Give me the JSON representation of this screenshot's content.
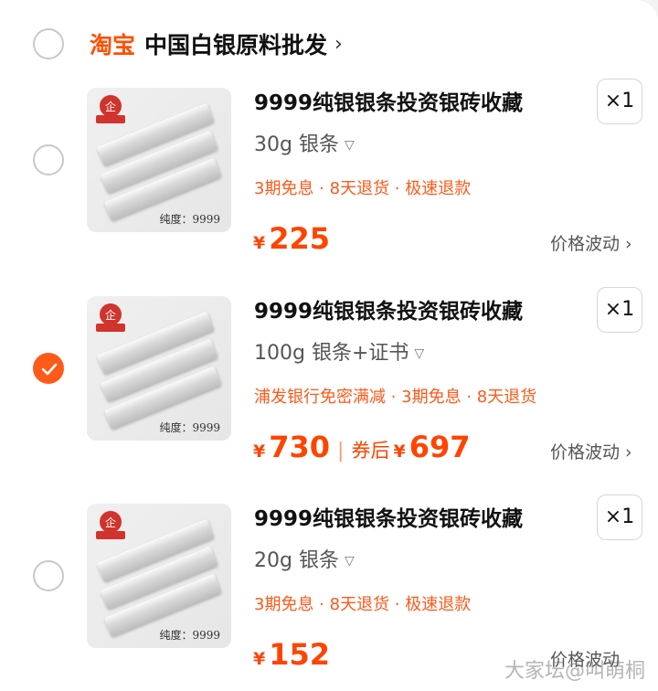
{
  "shop": {
    "brand": "淘宝",
    "name": "中国白银原料批发",
    "chevron": "›",
    "checked": false
  },
  "items": [
    {
      "title": "9999纯银银条投资银砖收藏",
      "quantity": "×1",
      "spec": "30g 银条",
      "promo": "3期免息 · 8天退货 · 极速退款",
      "price_symbol": "¥",
      "price": "225",
      "coupon_label": "",
      "coupon_price": "",
      "fluct": "价格波动 ›",
      "thumb_caption": "纯度：9999",
      "checked": false
    },
    {
      "title": "9999纯银银条投资银砖收藏",
      "quantity": "×1",
      "spec": "100g 银条+证书",
      "promo": "浦发银行免密满减 · 3期免息 · 8天退货",
      "price_symbol": "¥",
      "price": "730",
      "separator": "|",
      "coupon_label": "券后",
      "coupon_symbol": "¥",
      "coupon_price": "697",
      "fluct": "价格波动 ›",
      "thumb_caption": "纯度：9999",
      "checked": true
    },
    {
      "title": "9999纯银银条投资银砖收藏",
      "quantity": "×1",
      "spec": "20g 银条",
      "promo": "3期免息 · 8天退货 · 极速退款",
      "price_symbol": "¥",
      "price": "152",
      "coupon_label": "",
      "coupon_price": "",
      "fluct": "价格波动",
      "thumb_caption": "纯度：9999",
      "checked": false
    }
  ],
  "watermark": "大家坛@叫萌桐",
  "colors": {
    "accent": "#ff5000",
    "price": "#ff4400",
    "promo": "#ff5a1a"
  }
}
